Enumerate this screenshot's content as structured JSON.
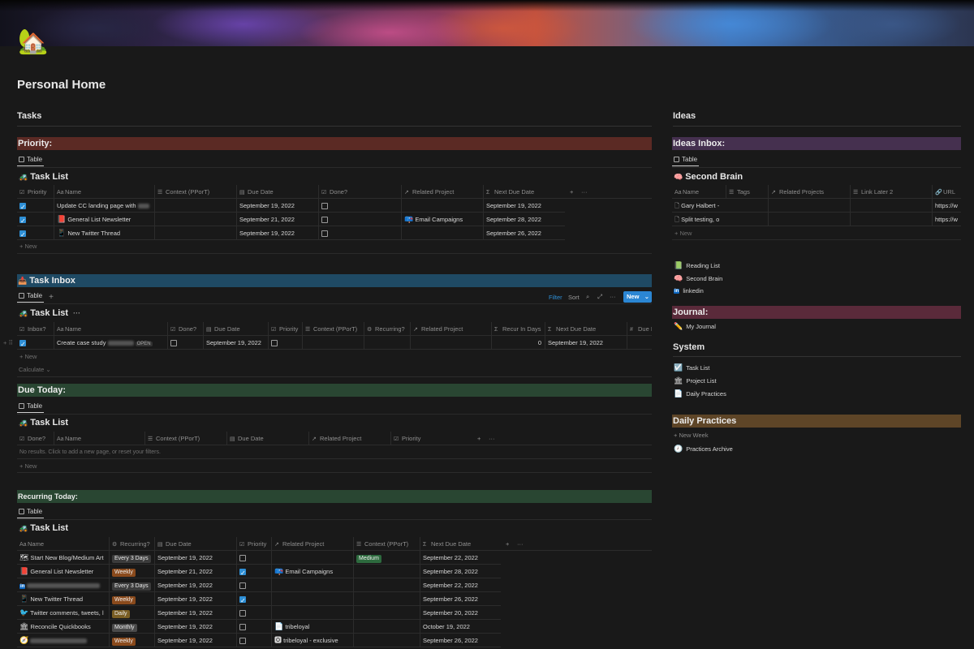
{
  "page": {
    "title": "Personal Home",
    "icon": "🏡"
  },
  "tasks_heading": "Tasks",
  "ideas_heading": "Ideas",
  "priority": {
    "bar": "Priority:",
    "tab": "Table",
    "db_icon": "🚜",
    "db_title": "Task List",
    "headers": [
      "Priority",
      "Name",
      "Context (PPorT)",
      "Due Date",
      "Done?",
      "Related Project",
      "Next Due Date"
    ],
    "rows": [
      {
        "priority": true,
        "icon": "",
        "name": "Update CC landing page with",
        "due": "September 19, 2022",
        "done": false,
        "project": "",
        "next": "September 19, 2022"
      },
      {
        "priority": true,
        "icon": "📕",
        "name": "General List Newsletter",
        "due": "September 21, 2022",
        "done": false,
        "project": "Email Campaigns",
        "next": "September 28, 2022"
      },
      {
        "priority": true,
        "icon": "📱",
        "name": "New Twitter Thread",
        "due": "September 19, 2022",
        "done": false,
        "project": "",
        "next": "September 26, 2022"
      }
    ],
    "new": "+ New"
  },
  "inbox": {
    "bar": "Task Inbox",
    "bar_icon": "📥",
    "tab": "Table",
    "add_view": "+",
    "filter": "Filter",
    "sort": "Sort",
    "new_btn": "New",
    "db_icon": "🚜",
    "db_title": "Task List",
    "more": "···",
    "headers": [
      "Inbox?",
      "Name",
      "Done?",
      "Due Date",
      "Priority",
      "Context (PPorT)",
      "Recurring?",
      "Related Project",
      "Recur In Days",
      "Next Due Date",
      "Due I"
    ],
    "rows": [
      {
        "inbox": true,
        "name": "Create case study",
        "open": "OPEN",
        "done": false,
        "due": "September 19, 2022",
        "priority": false,
        "recur_days": "0",
        "next": "September 19, 2022"
      }
    ],
    "new": "+ New",
    "calculate": "Calculate ⌄"
  },
  "due_today": {
    "bar": "Due Today:",
    "tab": "Table",
    "db_icon": "🚜",
    "db_title": "Task List",
    "headers": [
      "Done?",
      "Name",
      "Context (PPorT)",
      "Due Date",
      "Related Project",
      "Priority"
    ],
    "empty": "No results. Click to add a new page, or reset your filters.",
    "new": "+ New"
  },
  "recurring": {
    "bar": "Recurring Today:",
    "tab": "Table",
    "db_icon": "🚜",
    "db_title": "Task List",
    "headers": [
      "Name",
      "Recurring?",
      "Due Date",
      "Priority",
      "Related Project",
      "Context (PPorT)",
      "Next Due Date"
    ],
    "rows": [
      {
        "icon": "🗺",
        "name": "Start New Blog/Medium Art",
        "recur": "Every 3 Days",
        "recur_cls": "e3d",
        "due": "September 19, 2022",
        "priority": false,
        "project": "",
        "project_icon": "",
        "context": "Medium",
        "next": "September 22, 2022"
      },
      {
        "icon": "📕",
        "name": "General List Newsletter",
        "recur": "Weekly",
        "recur_cls": "weekly",
        "due": "September 21, 2022",
        "priority": true,
        "project": "Email Campaigns",
        "project_icon": "📪",
        "context": "",
        "next": "September 28, 2022"
      },
      {
        "icon": "in",
        "name": "",
        "recur": "Every 3 Days",
        "recur_cls": "e3d",
        "due": "September 19, 2022",
        "priority": false,
        "project": "",
        "project_icon": "",
        "context": "",
        "next": "September 22, 2022"
      },
      {
        "icon": "📱",
        "name": "New Twitter Thread",
        "recur": "Weekly",
        "recur_cls": "weekly",
        "due": "September 19, 2022",
        "priority": true,
        "project": "",
        "project_icon": "",
        "context": "",
        "next": "September 26, 2022"
      },
      {
        "icon": "🐦",
        "name": "Twitter comments, tweets, l",
        "recur": "Daily",
        "recur_cls": "daily",
        "due": "September 19, 2022",
        "priority": false,
        "project": "",
        "project_icon": "",
        "context": "",
        "next": "September 20, 2022"
      },
      {
        "icon": "🏛",
        "name": "Reconcile Quickbooks",
        "recur": "Monthly",
        "recur_cls": "monthly",
        "due": "September 19, 2022",
        "priority": false,
        "project": "tribeloyal",
        "project_icon": "📄",
        "context": "",
        "next": "October 19, 2022"
      },
      {
        "icon": "🧭",
        "name": "",
        "recur": "Weekly",
        "recur_cls": "weekly",
        "due": "September 19, 2022",
        "priority": false,
        "project": "tribeloyal - exclusive",
        "project_icon": "🅾",
        "context": "",
        "next": "September 26, 2022"
      }
    ]
  },
  "ideas_inbox": {
    "bar": "Ideas Inbox:",
    "tab": "Table",
    "db_icon": "🧠",
    "db_title": "Second Brain",
    "headers": [
      "Name",
      "Tags",
      "Related Projects",
      "Link Later 2",
      "URL"
    ],
    "rows": [
      {
        "name": "Gary Halbert -",
        "url": "https://w"
      },
      {
        "name": "Split testing, o",
        "url": "https://w"
      }
    ],
    "new": "+ New"
  },
  "links": [
    {
      "icon": "📗",
      "label": "Reading List"
    },
    {
      "icon": "🧠",
      "label": "Second Brain"
    },
    {
      "icon": "in",
      "label": "linkedin"
    }
  ],
  "journal": {
    "bar": "Journal:",
    "links": [
      {
        "icon": "✏️",
        "label": "My Journal"
      }
    ]
  },
  "system": {
    "heading": "System",
    "links": [
      {
        "icon": "☑️",
        "label": "Task List"
      },
      {
        "icon": "🏛",
        "label": "Project List"
      },
      {
        "icon": "📄",
        "label": "Daily Practices"
      }
    ]
  },
  "daily_practices": {
    "bar": "Daily Practices",
    "new_week": "+ New Week",
    "archive_icon": "🕗",
    "archive": "Practices Archive"
  },
  "colors": {
    "priority_bar": "#5b2a24",
    "inbox_bar": "#1f4a64",
    "due_bar": "#294632",
    "recurring_bar": "#294632",
    "ideas_bar": "#45304f",
    "journal_bar": "#5a2a3a",
    "daily_bar": "#5e4527",
    "accent": "#2e8fd6"
  }
}
